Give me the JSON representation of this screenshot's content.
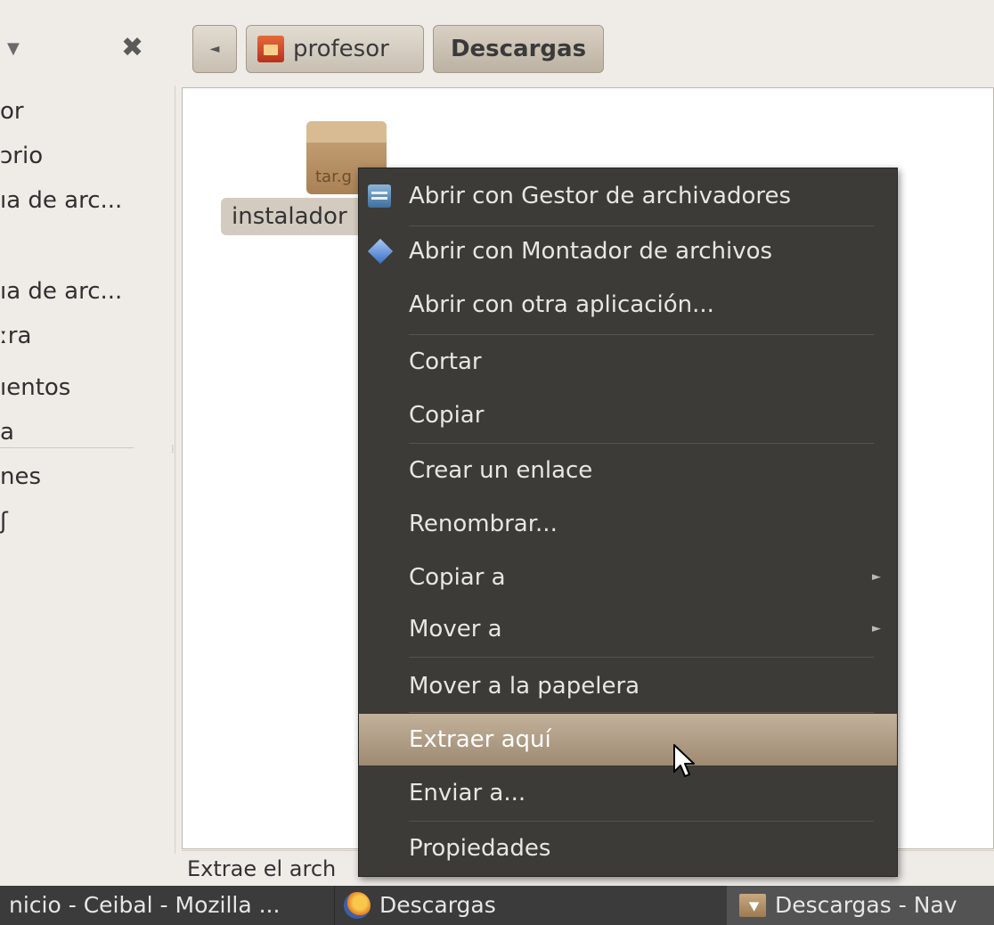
{
  "toolbar": {
    "back_label": "◄",
    "home_label": "profesor",
    "current_label": "Descargas"
  },
  "sidebar": {
    "items": [
      "or",
      "ɔrio",
      "ıa de arc...",
      "ıa de arc...",
      "ːra",
      "ıentos",
      "a",
      "nes",
      "ʃ"
    ]
  },
  "file": {
    "icon_ext": "tar.g",
    "label": "instalador"
  },
  "status": {
    "text": "Extrae el arch"
  },
  "context_menu": {
    "items": [
      {
        "label": "Abrir con Gestor de archivadores",
        "icon": "archive-manager-icon"
      },
      {
        "label": "Abrir con Montador de archivos",
        "icon": "archive-mounter-icon"
      },
      {
        "label": "Abrir con otra aplicación..."
      },
      {
        "label": "Cortar"
      },
      {
        "label": "Copiar"
      },
      {
        "label": "Crear un enlace"
      },
      {
        "label": "Renombrar..."
      },
      {
        "label": "Copiar a",
        "submenu": true
      },
      {
        "label": "Mover a",
        "submenu": true
      },
      {
        "label": "Mover a la papelera"
      },
      {
        "label": "Extraer aquí",
        "highlighted": true
      },
      {
        "label": "Enviar a..."
      },
      {
        "label": "Propiedades"
      }
    ],
    "submenu_arrow": "►"
  },
  "taskbar": {
    "tasks": [
      {
        "label": "nicio - Ceibal - Mozilla ..."
      },
      {
        "label": "Descargas",
        "icon": "firefox-icon"
      },
      {
        "label": "Descargas - Nav",
        "icon": "folder-icon",
        "active": true
      }
    ]
  },
  "colors": {
    "menu_bg": "#3c3b37",
    "menu_highlight": "#b09c84",
    "window_bg": "#efebe7",
    "taskbar_bg": "#3b3b3b"
  }
}
